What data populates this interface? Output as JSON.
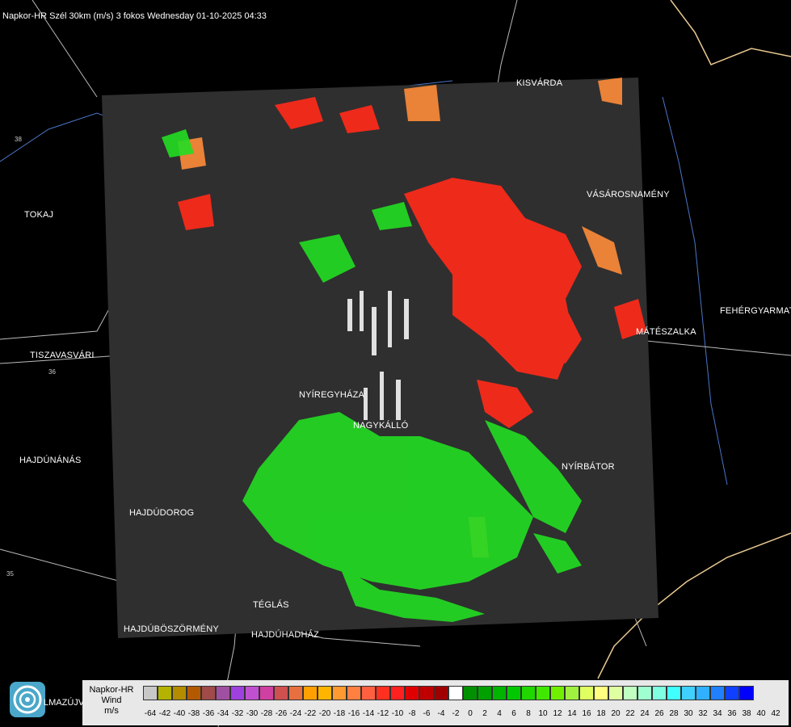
{
  "title": "Napkor-HR Szél 30km (m/s) 3 fokos Wednesday 01-10-2025 04:33",
  "cities": [
    {
      "name": "KISVÁRDA",
      "key": "kisvarda"
    },
    {
      "name": "TOKAJ",
      "key": "tokaj"
    },
    {
      "name": "VÁSÁROSNAMÉNY",
      "key": "vasarosnameny"
    },
    {
      "name": "FEHÉRGYARMAT",
      "key": "fehergyarmat"
    },
    {
      "name": "MÁTÉSZALKA",
      "key": "mateszalka"
    },
    {
      "name": "TISZAVASVÁRI",
      "key": "tiszavasvari"
    },
    {
      "name": "NYÍREGYHÁZA",
      "key": "nyiregyhaza"
    },
    {
      "name": "NAGYKÁLLÓ",
      "key": "nagykallo"
    },
    {
      "name": "HAJDÚNÁNÁS",
      "key": "hajdunanas"
    },
    {
      "name": "NYÍRBÁTOR",
      "key": "nyirbator"
    },
    {
      "name": "HAJDÚDOROG",
      "key": "hajdudorog"
    },
    {
      "name": "TÉGLÁS",
      "key": "teglas"
    },
    {
      "name": "HAJDÚBÖSZÖRMÉNY",
      "key": "hajduboszormeny"
    },
    {
      "name": "HAJDÚHADHÁZ",
      "key": "hajduhadhaz"
    }
  ],
  "footer_city": "LMAZÚJVÁR",
  "road_labels": {
    "r1": "38",
    "r2": "36",
    "r3": "35"
  },
  "legend": {
    "line1": "Napkor-HR",
    "line2": "Wind",
    "line3": "m/s",
    "swatches": [
      "#c8c8c8",
      "#b3b300",
      "#b38c00",
      "#b35a00",
      "#a04a4a",
      "#a050a0",
      "#a040e0",
      "#c050d0",
      "#d040a0",
      "#d05050",
      "#e87040",
      "#ffa000",
      "#ffb400",
      "#ff9a30",
      "#ff8040",
      "#ff6040",
      "#ff3020",
      "#ff2020",
      "#e00000",
      "#c00000",
      "#a00000",
      "#ffffff",
      "#009000",
      "#00a000",
      "#00b400",
      "#00c800",
      "#20d800",
      "#40e800",
      "#70f000",
      "#a0f040",
      "#e0ff60",
      "#ffff80",
      "#e0ffa0",
      "#c0ffc0",
      "#a0ffd0",
      "#80ffe0",
      "#40ffff",
      "#40d0ff",
      "#30b0ff",
      "#2080ff",
      "#1040ff",
      "#0000ff"
    ],
    "ticks": [
      "-64",
      "-42",
      "-40",
      "-38",
      "-36",
      "-34",
      "-32",
      "-30",
      "-28",
      "-26",
      "-24",
      "-22",
      "-20",
      "-18",
      "-16",
      "-14",
      "-12",
      "-10",
      "-8",
      "-6",
      "-4",
      "-2",
      "0",
      "2",
      "4",
      "6",
      "8",
      "10",
      "12",
      "14",
      "16",
      "18",
      "20",
      "22",
      "24",
      "26",
      "28",
      "30",
      "32",
      "34",
      "36",
      "38",
      "40",
      "42"
    ]
  },
  "colors": {
    "radar_bg": "#2f2f2f",
    "approach": "#ff2a1a",
    "recede": "#22dd22"
  }
}
